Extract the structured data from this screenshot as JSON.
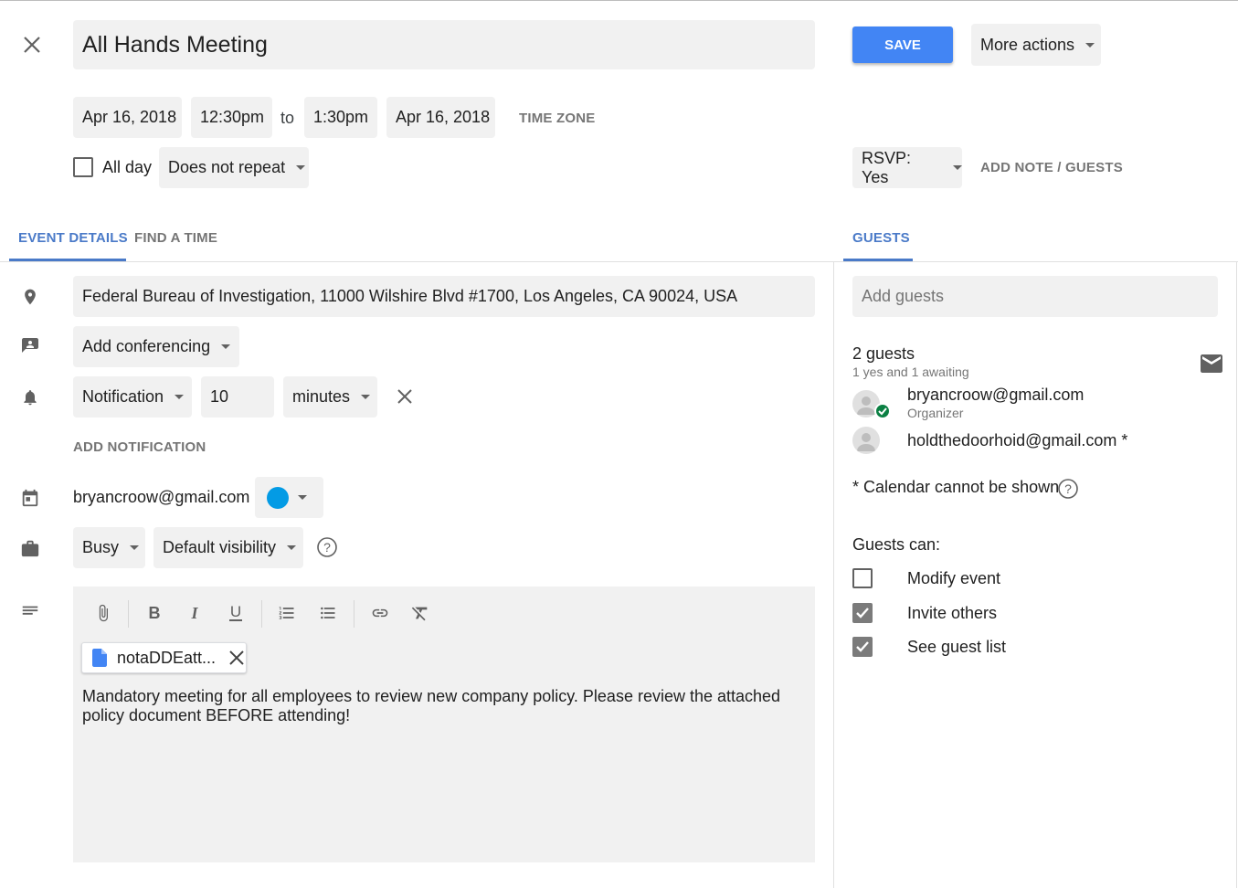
{
  "header": {
    "title": "All Hands Meeting",
    "save_label": "SAVE",
    "more_actions_label": "More actions"
  },
  "datetime": {
    "start_date": "Apr 16, 2018",
    "start_time": "12:30pm",
    "to_label": "to",
    "end_time": "1:30pm",
    "end_date": "Apr 16, 2018",
    "time_zone_label": "TIME ZONE",
    "all_day_label": "All day",
    "repeat_label": "Does not repeat"
  },
  "rsvp": {
    "label": "RSVP: Yes",
    "add_note_label": "ADD NOTE / GUESTS"
  },
  "tabs": [
    {
      "label": "EVENT DETAILS",
      "active": true
    },
    {
      "label": "FIND A TIME",
      "active": false
    }
  ],
  "guests_tab_label": "GUESTS",
  "details": {
    "location": "Federal Bureau of Investigation, 11000 Wilshire Blvd #1700, Los Angeles, CA 90024, USA",
    "conferencing_label": "Add conferencing",
    "notification_type": "Notification",
    "notification_value": "10",
    "notification_unit": "minutes",
    "add_notification_label": "ADD NOTIFICATION",
    "calendar_owner": "bryancroow@gmail.com",
    "calendar_color": "#039be5",
    "availability": "Busy",
    "visibility": "Default visibility",
    "attachment_name": "notaDDEatt...",
    "description": "Mandatory meeting for all employees to review new company policy. Please review the attached policy document BEFORE attending!"
  },
  "guests": {
    "add_placeholder": "Add guests",
    "count_label": "2 guests",
    "summary": "1 yes and 1 awaiting",
    "list": [
      {
        "email": "bryancroow@gmail.com",
        "role": "Organizer",
        "accepted": true
      },
      {
        "email": "holdthedoorhoid@gmail.com *",
        "role": "",
        "accepted": false
      }
    ],
    "calendar_note": "* Calendar cannot be shown",
    "permissions_heading": "Guests can:",
    "permissions": [
      {
        "label": "Modify event",
        "checked": false
      },
      {
        "label": "Invite others",
        "checked": true
      },
      {
        "label": "See guest list",
        "checked": true
      }
    ]
  },
  "colors": {
    "accent": "#4a7ac8",
    "save_button": "#4285f4",
    "check_green": "#0b8043"
  }
}
